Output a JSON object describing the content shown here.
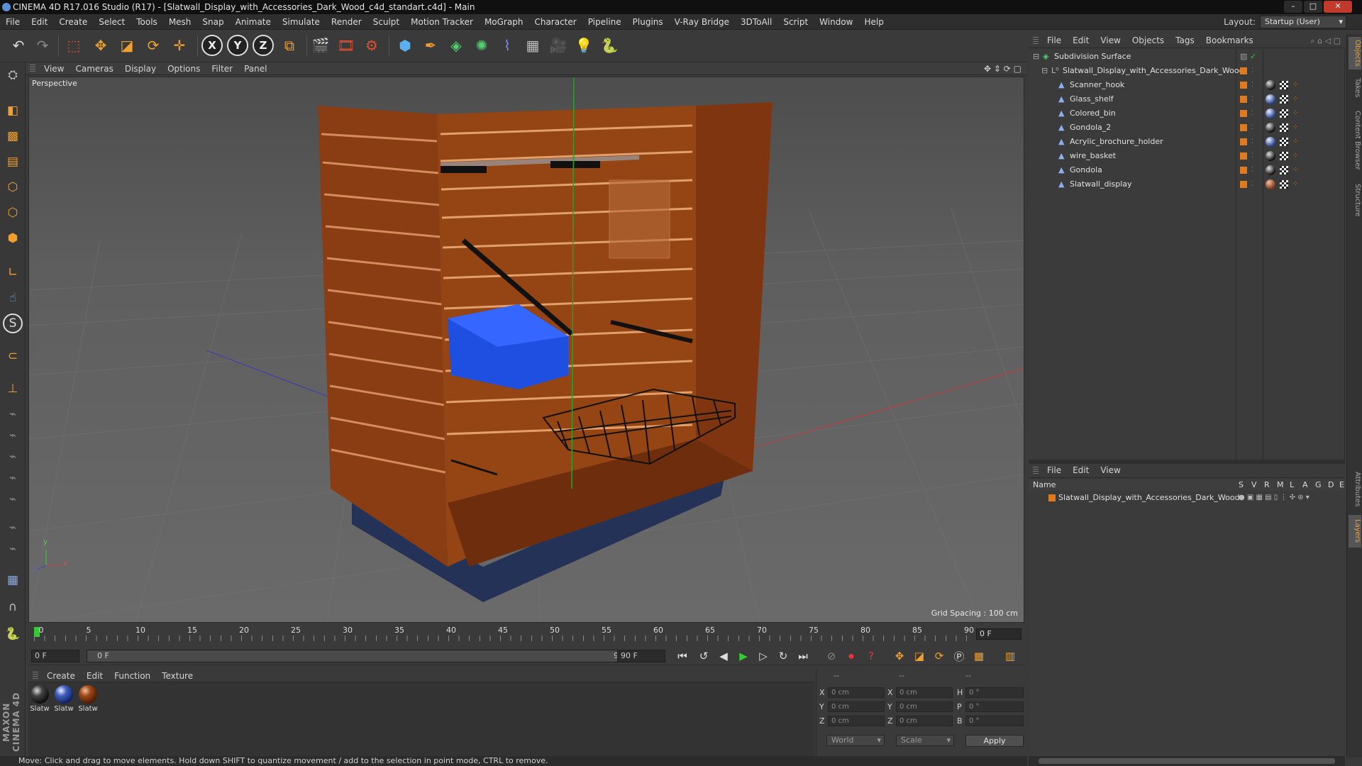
{
  "window": {
    "title": "CINEMA 4D R17.016 Studio (R17) - [Slatwall_Display_with_Accessories_Dark_Wood_c4d_standart.c4d] - Main",
    "minimize": "–",
    "maximize": "□",
    "close": "✕"
  },
  "menubar": {
    "items": [
      "File",
      "Edit",
      "Create",
      "Select",
      "Tools",
      "Mesh",
      "Snap",
      "Animate",
      "Simulate",
      "Render",
      "Sculpt",
      "Motion Tracker",
      "MoGraph",
      "Character",
      "Pipeline",
      "Plugins",
      "V-Ray Bridge",
      "3DToAll",
      "Script",
      "Window",
      "Help"
    ],
    "layout_label": "Layout:",
    "layout_value": "Startup (User)"
  },
  "toolbar": {
    "x_label": "X",
    "y_label": "Y",
    "z_label": "Z"
  },
  "viewport": {
    "menu": [
      "View",
      "Cameras",
      "Display",
      "Options",
      "Filter",
      "Panel"
    ],
    "label": "Perspective",
    "grid_spacing": "Grid Spacing : 100 cm",
    "axis_y": "y",
    "axis_z": "z",
    "axis_x": "x"
  },
  "timeline": {
    "ticks": [
      "0",
      "5",
      "10",
      "15",
      "20",
      "25",
      "30",
      "35",
      "40",
      "45",
      "50",
      "55",
      "60",
      "65",
      "70",
      "75",
      "80",
      "85",
      "90"
    ],
    "current_frame": "0 F"
  },
  "transport": {
    "start_field": "0 F",
    "range_start": "0 F",
    "range_end": "90 F",
    "end_field": "90 F"
  },
  "materials": {
    "menu": [
      "Create",
      "Edit",
      "Function",
      "Texture"
    ],
    "items": [
      {
        "label": "Slatw",
        "color": "#1a1a1a"
      },
      {
        "label": "Slatw",
        "color": "#2a3f9a"
      },
      {
        "label": "Slatw",
        "color": "#7a3412"
      }
    ],
    "logo_text": "MAXON CINEMA 4D"
  },
  "coords": {
    "header_a": "--",
    "header_b": "--",
    "header_c": "--",
    "rows": [
      {
        "l1": "X",
        "v1": "0 cm",
        "l2": "X",
        "v2": "0 cm",
        "l3": "H",
        "v3": "0 °"
      },
      {
        "l1": "Y",
        "v1": "0 cm",
        "l2": "Y",
        "v2": "0 cm",
        "l3": "P",
        "v3": "0 °"
      },
      {
        "l1": "Z",
        "v1": "0 cm",
        "l2": "Z",
        "v2": "0 cm",
        "l3": "B",
        "v3": "0 °"
      }
    ],
    "space_select": "World",
    "mode_select": "Scale",
    "apply": "Apply"
  },
  "object_manager": {
    "menu": [
      "File",
      "Edit",
      "View",
      "Objects",
      "Tags",
      "Bookmarks"
    ],
    "root": "Subdivision Surface",
    "group": "Slatwall_Display_with_Accessories_Dark_Wood",
    "children": [
      "Scanner_hook",
      "Glass_shelf",
      "Colored_bin",
      "Gondola_2",
      "Acrylic_brochure_holder",
      "wire_basket",
      "Gondola",
      "Slatwall_display"
    ]
  },
  "layer_manager": {
    "menu": [
      "File",
      "Edit",
      "View"
    ],
    "columns": [
      "Name",
      "S",
      "V",
      "R",
      "M",
      "L",
      "A",
      "G",
      "D",
      "E"
    ],
    "rows": [
      "Slatwall_Display_with_Accessories_Dark_Wood"
    ]
  },
  "right_tabs": [
    "Objects",
    "Takes",
    "Content Browser",
    "Structure",
    "Attributes",
    "Layers"
  ],
  "status": "Move: Click and drag to move elements. Hold down SHIFT to quantize movement / add to the selection in point mode, CTRL to remove.",
  "colors": {
    "accent_orange": "#e07a1f",
    "wood": "#8a3c12",
    "bin_blue": "#1f4fe0"
  }
}
